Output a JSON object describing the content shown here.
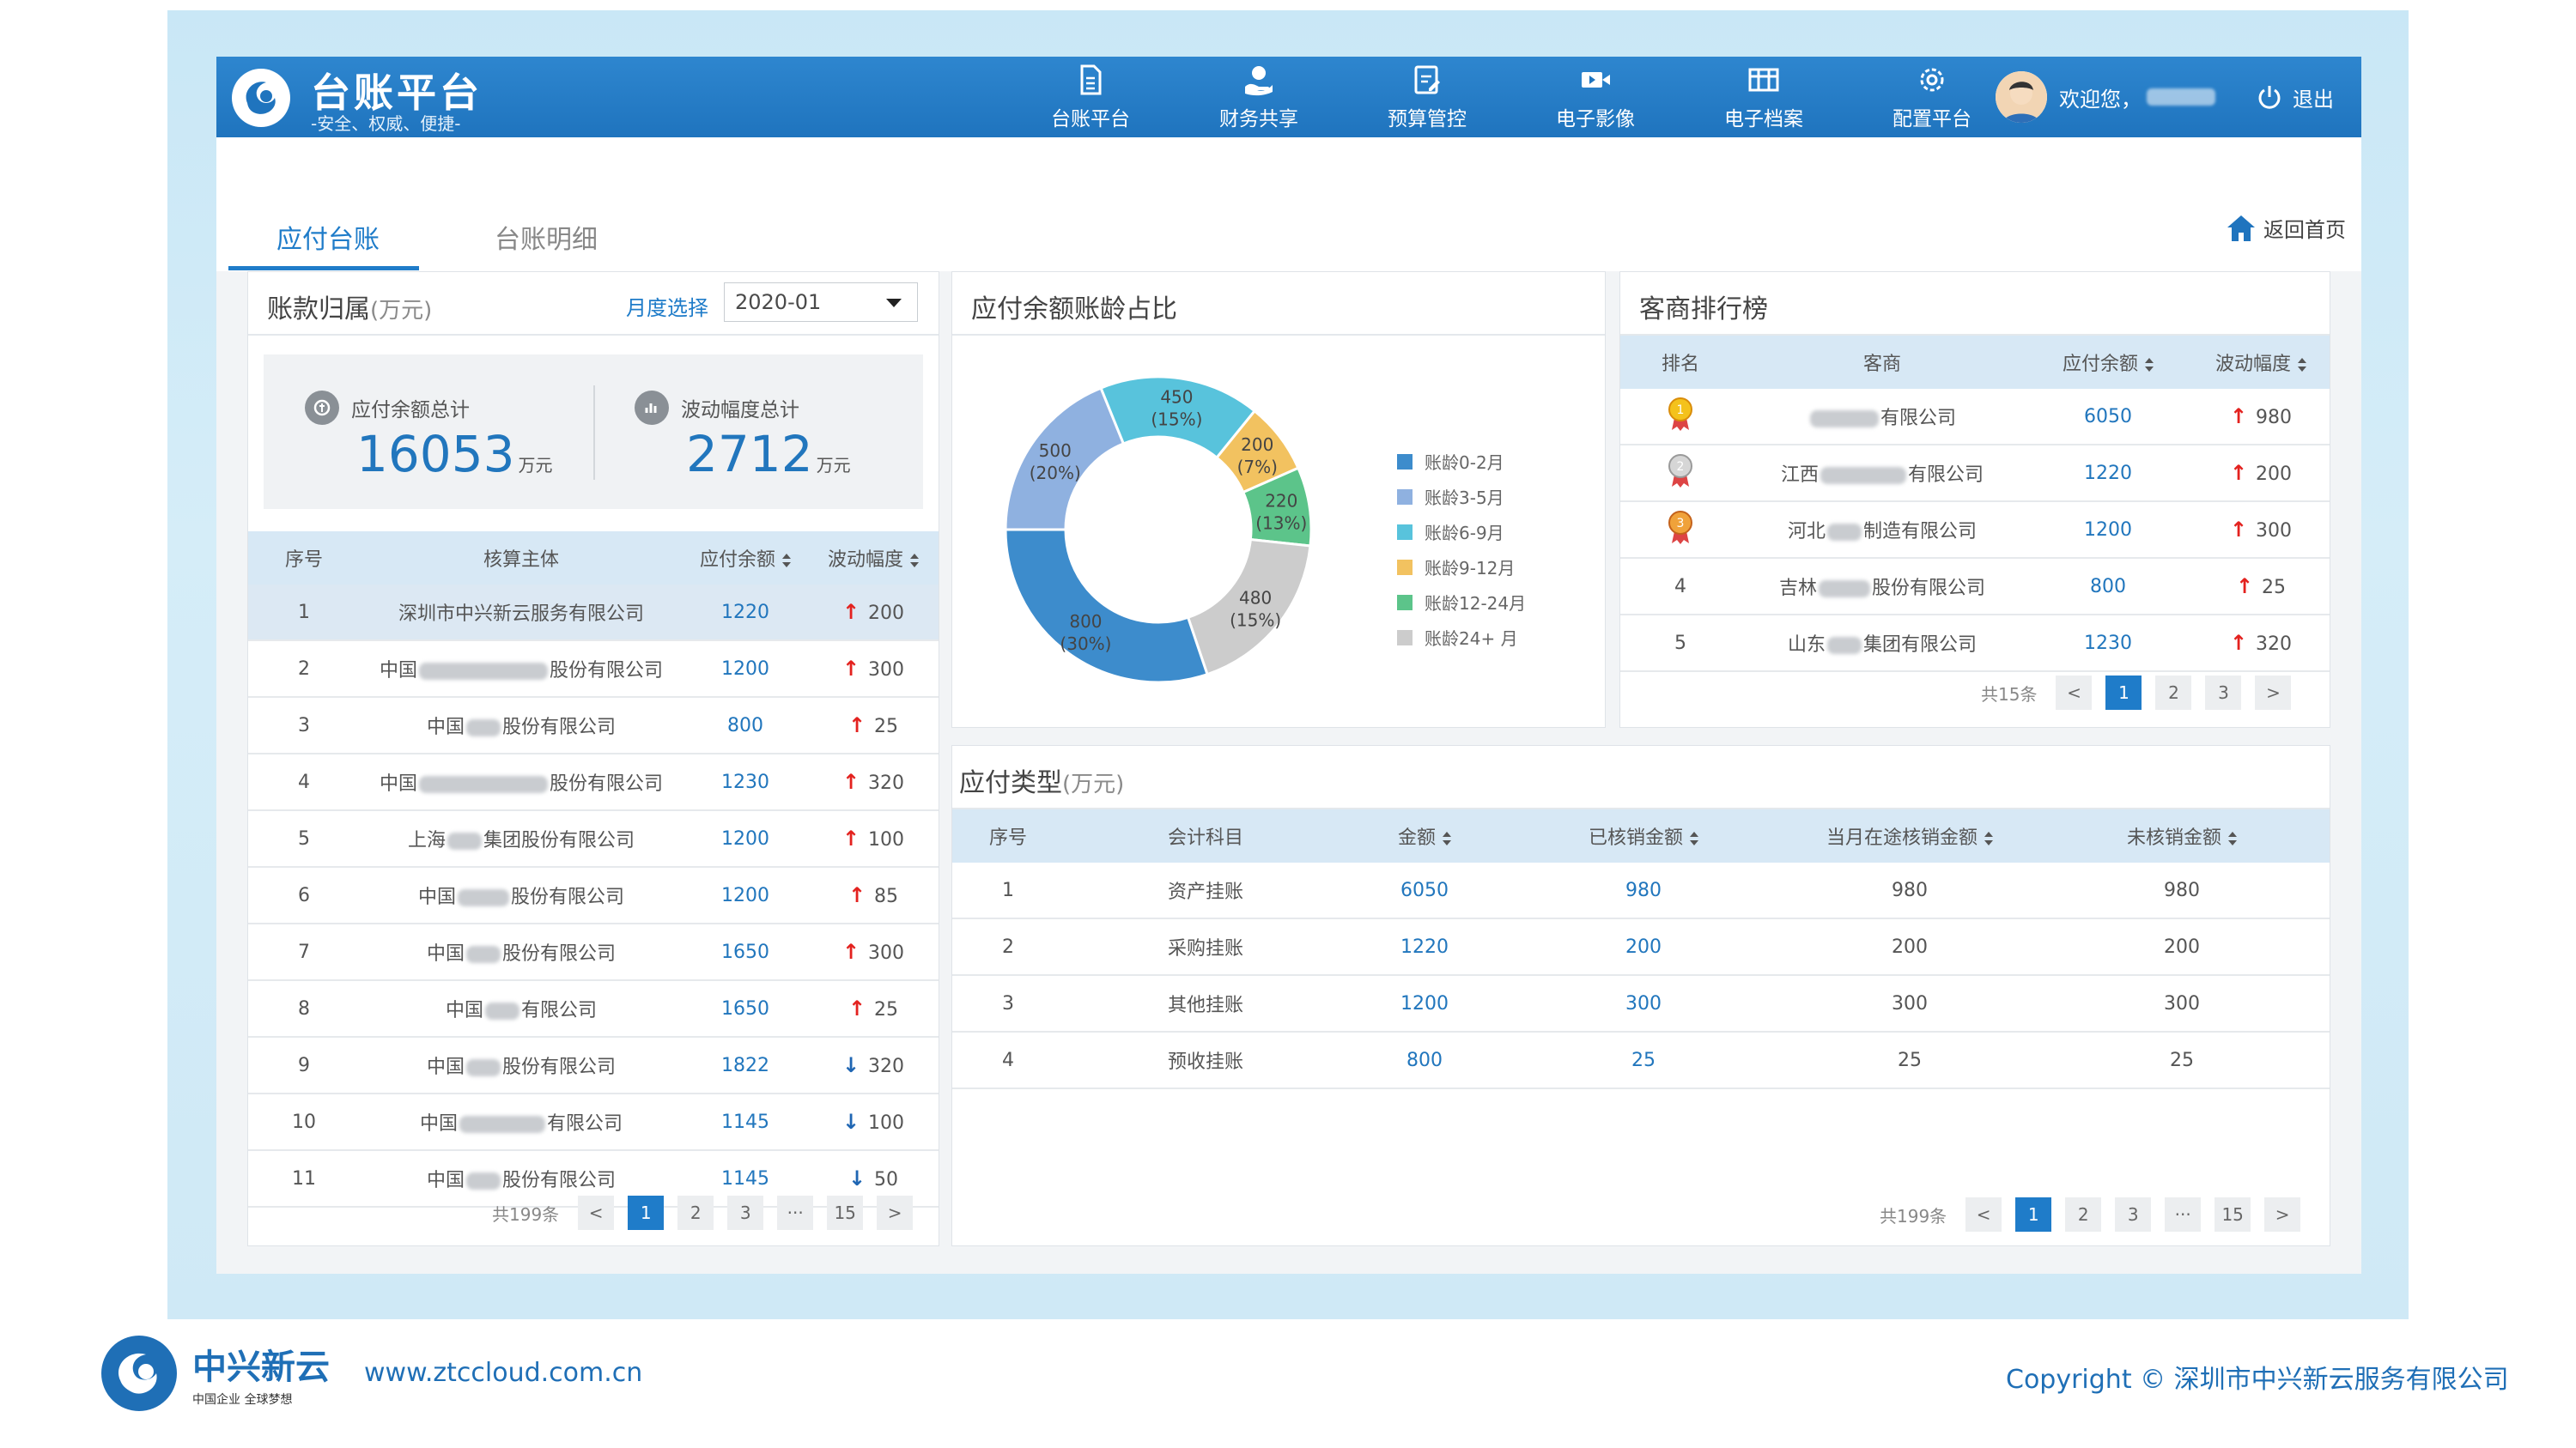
{
  "header": {
    "brand_title": "台账平台",
    "brand_subtitle": "-安全、权威、便捷-",
    "nav": [
      {
        "label": "台账平台",
        "icon": "document-icon"
      },
      {
        "label": "财务共享",
        "icon": "hand-coin-icon"
      },
      {
        "label": "预算管控",
        "icon": "budget-edit-icon"
      },
      {
        "label": "电子影像",
        "icon": "video-camera-icon"
      },
      {
        "label": "电子档案",
        "icon": "archive-icon"
      },
      {
        "label": "配置平台",
        "icon": "settings-gear-icon"
      }
    ],
    "welcome": "欢迎您，",
    "logout": "退出"
  },
  "tabs": {
    "active": "应付台账",
    "other": "台账明细",
    "home": "返回首页"
  },
  "account_card": {
    "title": "账款归属",
    "unit": "(万元)",
    "month_label": "月度选择",
    "month_value": "2020-01",
    "total_label": "应付余额总计",
    "total_value": "16053",
    "fluct_label": "波动幅度总计",
    "fluct_value": "2712",
    "unit_text": "万元",
    "columns": [
      "序号",
      "核算主体",
      "应付余额",
      "波动幅度"
    ],
    "rows": [
      {
        "no": "1",
        "pre": "深圳市中兴新云服务有限公司",
        "mask": 0,
        "post": "",
        "amount": "1220",
        "dir": "up",
        "delta": "200"
      },
      {
        "no": "2",
        "pre": "中国",
        "mask": 150,
        "post": "股份有限公司",
        "amount": "1200",
        "dir": "up",
        "delta": "300"
      },
      {
        "no": "3",
        "pre": "中国",
        "mask": 40,
        "post": "股份有限公司",
        "amount": "800",
        "dir": "up",
        "delta": "25"
      },
      {
        "no": "4",
        "pre": "中国",
        "mask": 150,
        "post": "股份有限公司",
        "amount": "1230",
        "dir": "up",
        "delta": "320"
      },
      {
        "no": "5",
        "pre": "上海",
        "mask": 40,
        "post": "集团股份有限公司",
        "amount": "1200",
        "dir": "up",
        "delta": "100"
      },
      {
        "no": "6",
        "pre": "中国",
        "mask": 60,
        "post": "股份有限公司",
        "amount": "1200",
        "dir": "up",
        "delta": "85"
      },
      {
        "no": "7",
        "pre": "中国",
        "mask": 40,
        "post": "股份有限公司",
        "amount": "1650",
        "dir": "up",
        "delta": "300"
      },
      {
        "no": "8",
        "pre": "中国",
        "mask": 40,
        "post": "有限公司",
        "amount": "1650",
        "dir": "up",
        "delta": "25"
      },
      {
        "no": "9",
        "pre": "中国",
        "mask": 40,
        "post": "股份有限公司",
        "amount": "1822",
        "dir": "down",
        "delta": "320"
      },
      {
        "no": "10",
        "pre": "中国",
        "mask": 100,
        "post": "有限公司",
        "amount": "1145",
        "dir": "down",
        "delta": "100"
      },
      {
        "no": "11",
        "pre": "中国",
        "mask": 40,
        "post": "股份有限公司",
        "amount": "1145",
        "dir": "down",
        "delta": "50"
      }
    ],
    "pager": {
      "total": "共199条",
      "prev": "<",
      "pages": [
        "1",
        "2",
        "3",
        "···",
        "15"
      ],
      "next": ">"
    }
  },
  "aging_card": {
    "title": "应付余额账龄占比",
    "slices": [
      {
        "label": "账龄0-2月",
        "value": 800,
        "pct": "(30%)",
        "color": "#3d8ccc"
      },
      {
        "label": "账龄3-5月",
        "value": 500,
        "pct": "(20%)",
        "color": "#8fb1e0"
      },
      {
        "label": "账龄6-9月",
        "value": 450,
        "pct": "(15%)",
        "color": "#58c3dc"
      },
      {
        "label": "账龄9-12月",
        "value": 200,
        "pct": "(7%)",
        "color": "#f2c260"
      },
      {
        "label": "账龄12-24月",
        "value": 220,
        "pct": "(13%)",
        "color": "#5cc48a"
      },
      {
        "label": "账龄24+ 月",
        "value": 480,
        "pct": "(15%)",
        "color": "#cccccc"
      }
    ]
  },
  "ranking_card": {
    "title": "客商排行榜",
    "columns": [
      "排名",
      "客商",
      "应付余额",
      "波动幅度"
    ],
    "rows": [
      {
        "rank": "1",
        "medal": "gold",
        "pre": "",
        "mask": 80,
        "post": "有限公司",
        "amount": "6050",
        "delta": "980"
      },
      {
        "rank": "2",
        "medal": "silver",
        "pre": "江西",
        "mask": 100,
        "post": "有限公司",
        "amount": "1220",
        "delta": "200"
      },
      {
        "rank": "3",
        "medal": "bronze",
        "pre": "河北",
        "mask": 40,
        "post": "制造有限公司",
        "amount": "1200",
        "delta": "300"
      },
      {
        "rank": "4",
        "medal": "",
        "pre": "吉林",
        "mask": 60,
        "post": "股份有限公司",
        "amount": "800",
        "delta": "25"
      },
      {
        "rank": "5",
        "medal": "",
        "pre": "山东",
        "mask": 40,
        "post": "集团有限公司",
        "amount": "1230",
        "delta": "320"
      }
    ],
    "pager": {
      "total": "共15条",
      "prev": "<",
      "pages": [
        "1",
        "2",
        "3"
      ],
      "next": ">"
    }
  },
  "type_card": {
    "title": "应付类型",
    "unit": "(万元)",
    "columns": [
      "序号",
      "会计科目",
      "金额",
      "已核销金额",
      "当月在途核销金额",
      "未核销金额"
    ],
    "rows": [
      {
        "no": "1",
        "subject": "资产挂账",
        "amount": "6050",
        "written": "980",
        "transit": "980",
        "open": "980"
      },
      {
        "no": "2",
        "subject": "采购挂账",
        "amount": "1220",
        "written": "200",
        "transit": "200",
        "open": "200"
      },
      {
        "no": "3",
        "subject": "其他挂账",
        "amount": "1200",
        "written": "300",
        "transit": "300",
        "open": "300"
      },
      {
        "no": "4",
        "subject": "预收挂账",
        "amount": "800",
        "written": "25",
        "transit": "25",
        "open": "25"
      }
    ],
    "pager": {
      "total": "共199条",
      "prev": "<",
      "pages": [
        "1",
        "2",
        "3",
        "···",
        "15"
      ],
      "next": ">"
    }
  },
  "footer": {
    "brand": "中兴新云",
    "tagline": "中国企业 全球梦想",
    "url": "www.ztccloud.com.cn",
    "copyright": "Copyright © 深圳市中兴新云服务有限公司"
  },
  "colors": {
    "primary": "#1f7cc9",
    "up": "#e3221f",
    "down": "#1f66b3"
  }
}
